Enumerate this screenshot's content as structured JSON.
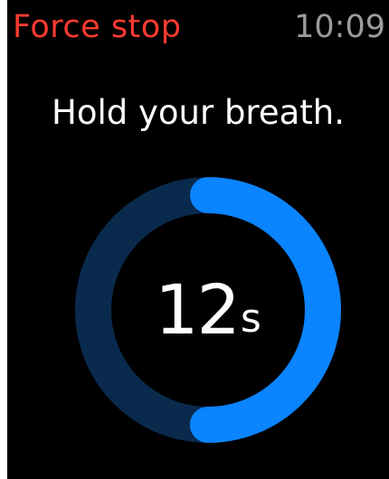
{
  "status_bar": {
    "force_stop_label": "Force stop",
    "time": "10:09"
  },
  "prompt": "Hold your breath.",
  "countdown": {
    "value": "12",
    "unit": "s",
    "progress_fraction": 0.5
  },
  "colors": {
    "background": "#000000",
    "force_stop": "#ff3b30",
    "time": "#9b9b9b",
    "text": "#ffffff",
    "ring_track": "#0a2a4d",
    "ring_progress": "#0a84ff"
  }
}
